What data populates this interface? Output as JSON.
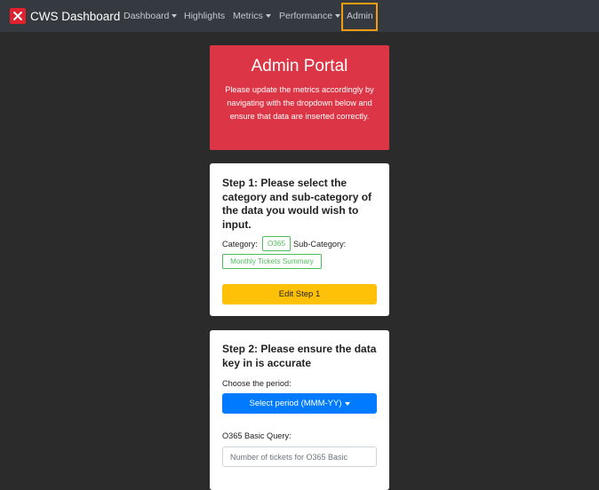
{
  "navbar": {
    "brand": "CWS Dashboard",
    "items": [
      {
        "label": "Dashboard",
        "has_dropdown": true
      },
      {
        "label": "Highlights",
        "has_dropdown": false
      },
      {
        "label": "Metrics",
        "has_dropdown": true
      },
      {
        "label": "Performance",
        "has_dropdown": true
      },
      {
        "label": "Admin",
        "has_dropdown": false,
        "highlighted": true
      }
    ],
    "highlight_color": "#f39c12"
  },
  "portal": {
    "title": "Admin Portal",
    "description": "Please update the metrics accordingly by navigating with the dropdown below and ensure that data are inserted correctly."
  },
  "step1": {
    "title": "Step 1: Please select the category and sub-category of the data you would wish to input.",
    "category_label": "Category:",
    "category_value": "O365",
    "subcategory_label": "Sub-Category:",
    "subcategory_value": "Monthly Tickets Summary",
    "edit_button": "Edit Step 1"
  },
  "step2": {
    "title": "Step 2: Please ensure the data key in is accurate",
    "period_label": "Choose the period:",
    "period_button": "Select period (MMM-YY)",
    "query_label": "O365 Basic Query:",
    "query_placeholder": "Number of tickets for O365 Basic"
  },
  "colors": {
    "background": "#2b2b2b",
    "navbar": "#343a40",
    "danger": "#dc3545",
    "warning": "#ffc107",
    "primary": "#007bff",
    "success_outline": "#4fbd5a"
  }
}
